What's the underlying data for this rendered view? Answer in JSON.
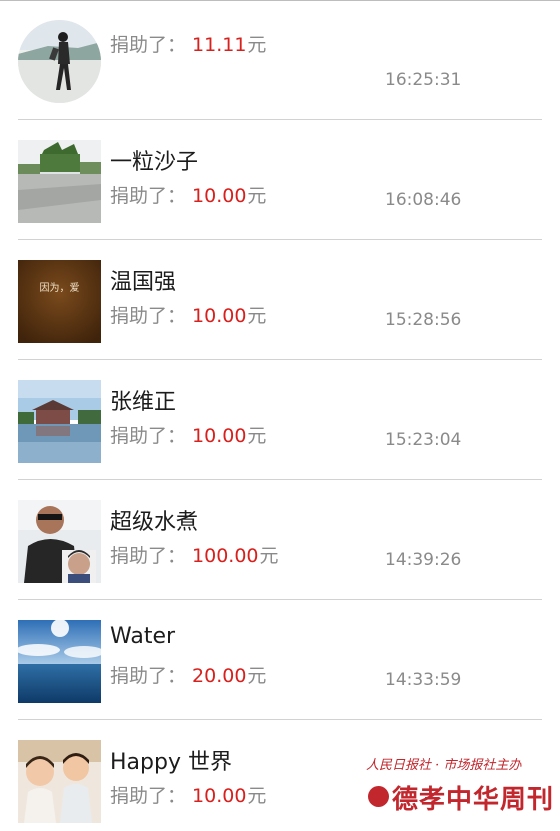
{
  "donors": [
    {
      "name": "",
      "label": "捐助了：",
      "amount": "11.11",
      "unit": "元",
      "time": "16:25:31",
      "avatar": "person-walking-photo"
    },
    {
      "name": "一粒沙子",
      "label": "捐助了：",
      "amount": "10.00",
      "unit": "元",
      "time": "16:08:46",
      "avatar": "garden-photo"
    },
    {
      "name": "温国强",
      "label": "捐助了：",
      "amount": "10.00",
      "unit": "元",
      "time": "15:28:56",
      "avatar": "book-cover",
      "avatar_text": "因为，爱"
    },
    {
      "name": "张维正",
      "label": "捐助了：",
      "amount": "10.00",
      "unit": "元",
      "time": "15:23:04",
      "avatar": "lake-house-photo"
    },
    {
      "name": "超级水煮",
      "label": "捐助了：",
      "amount": "100.00",
      "unit": "元",
      "time": "14:39:26",
      "avatar": "man-with-child-photo"
    },
    {
      "name": "Water",
      "label": "捐助了：",
      "amount": "20.00",
      "unit": "元",
      "time": "14:33:59",
      "avatar": "ocean-sky-photo"
    },
    {
      "name": "Happy 世界",
      "label": "捐助了：",
      "amount": "10.00",
      "unit": "元",
      "time": "",
      "avatar": "two-children-photo"
    }
  ],
  "watermark": {
    "line1": "人民日报社 · 市场报社主办",
    "brand": "德孝中华周刊"
  },
  "colors": {
    "amount": "#d8201c",
    "text": "#1c1c1c",
    "muted": "#8a8a8a",
    "divider": "#d2d2d2"
  }
}
